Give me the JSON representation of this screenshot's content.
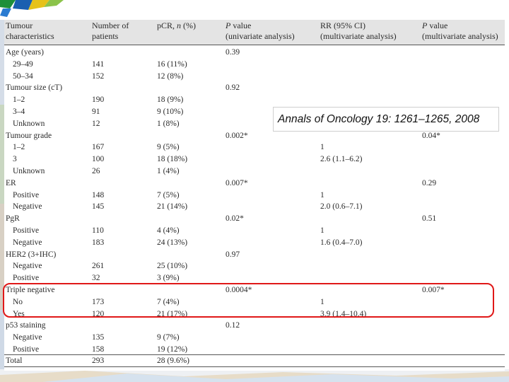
{
  "headers": [
    {
      "line1": "Tumour",
      "line2": "characteristics"
    },
    {
      "line1": "Number of",
      "line2": "patients"
    },
    {
      "line1_pre": "pCR, ",
      "line1_it": "n",
      "line1_post": " (%)",
      "line2": ""
    },
    {
      "line1_it": "P",
      "line1_post": " value",
      "line2": "(univariate analysis)"
    },
    {
      "line1_pre": "RR (95% CI)",
      "line2": "(multivariate analysis)"
    },
    {
      "line1_it": "P",
      "line1_post": " value",
      "line2": "(multivariate analysis)"
    }
  ],
  "rows": [
    {
      "label": "Age (years)",
      "indent": false,
      "n": "",
      "pcr": "",
      "p_uni": "0.39",
      "rr": "",
      "p_multi": ""
    },
    {
      "label": "29–49",
      "indent": true,
      "n": "141",
      "pcr": "16 (11%)",
      "p_uni": "",
      "rr": "",
      "p_multi": ""
    },
    {
      "label": "50–34",
      "indent": true,
      "n": "152",
      "pcr": "12 (8%)",
      "p_uni": "",
      "rr": "",
      "p_multi": ""
    },
    {
      "label": "Tumour size (cT)",
      "indent": false,
      "n": "",
      "pcr": "",
      "p_uni": "0.92",
      "rr": "",
      "p_multi": ""
    },
    {
      "label": "1–2",
      "indent": true,
      "n": "190",
      "pcr": "18 (9%)",
      "p_uni": "",
      "rr": "",
      "p_multi": ""
    },
    {
      "label": "3–4",
      "indent": true,
      "n": "91",
      "pcr": "9 (10%)",
      "p_uni": "",
      "rr": "",
      "p_multi": ""
    },
    {
      "label": "Unknown",
      "indent": true,
      "n": "12",
      "pcr": "1 (8%)",
      "p_uni": "",
      "rr": "",
      "p_multi": ""
    },
    {
      "label": "Tumour grade",
      "indent": false,
      "n": "",
      "pcr": "",
      "p_uni": "0.002*",
      "rr": "",
      "p_multi": "0.04*"
    },
    {
      "label": "1–2",
      "indent": true,
      "n": "167",
      "pcr": "9 (5%)",
      "p_uni": "",
      "rr": "1",
      "p_multi": ""
    },
    {
      "label": "3",
      "indent": true,
      "n": "100",
      "pcr": "18 (18%)",
      "p_uni": "",
      "rr": "2.6 (1.1–6.2)",
      "p_multi": ""
    },
    {
      "label": "Unknown",
      "indent": true,
      "n": "26",
      "pcr": "1 (4%)",
      "p_uni": "",
      "rr": "",
      "p_multi": ""
    },
    {
      "label": "ER",
      "indent": false,
      "n": "",
      "pcr": "",
      "p_uni": "0.007*",
      "rr": "",
      "p_multi": "0.29"
    },
    {
      "label": "Positive",
      "indent": true,
      "n": "148",
      "pcr": "7 (5%)",
      "p_uni": "",
      "rr": "1",
      "p_multi": ""
    },
    {
      "label": "Negative",
      "indent": true,
      "n": "145",
      "pcr": "21 (14%)",
      "p_uni": "",
      "rr": "2.0 (0.6–7.1)",
      "p_multi": ""
    },
    {
      "label": "PgR",
      "indent": false,
      "n": "",
      "pcr": "",
      "p_uni": "0.02*",
      "rr": "",
      "p_multi": "0.51"
    },
    {
      "label": "Positive",
      "indent": true,
      "n": "110",
      "pcr": "4 (4%)",
      "p_uni": "",
      "rr": "1",
      "p_multi": ""
    },
    {
      "label": "Negative",
      "indent": true,
      "n": "183",
      "pcr": "24 (13%)",
      "p_uni": "",
      "rr": "1.6 (0.4–7.0)",
      "p_multi": ""
    },
    {
      "label": "HER2 (3+IHC)",
      "indent": false,
      "n": "",
      "pcr": "",
      "p_uni": "0.97",
      "rr": "",
      "p_multi": ""
    },
    {
      "label": "Negative",
      "indent": true,
      "n": "261",
      "pcr": "25 (10%)",
      "p_uni": "",
      "rr": "",
      "p_multi": ""
    },
    {
      "label": "Positive",
      "indent": true,
      "n": "32",
      "pcr": "3 (9%)",
      "p_uni": "",
      "rr": "",
      "p_multi": ""
    },
    {
      "label": "Triple negative",
      "indent": false,
      "n": "",
      "pcr": "",
      "p_uni": "0.0004*",
      "rr": "",
      "p_multi": "0.007*"
    },
    {
      "label": "No",
      "indent": true,
      "n": "173",
      "pcr": "7 (4%)",
      "p_uni": "",
      "rr": "1",
      "p_multi": ""
    },
    {
      "label": "Yes",
      "indent": true,
      "n": "120",
      "pcr": "21 (17%)",
      "p_uni": "",
      "rr": "3.9 (1.4–10.4)",
      "p_multi": ""
    },
    {
      "label": "p53 staining",
      "indent": false,
      "n": "",
      "pcr": "",
      "p_uni": "0.12",
      "rr": "",
      "p_multi": ""
    },
    {
      "label": "Negative",
      "indent": true,
      "n": "135",
      "pcr": "9 (7%)",
      "p_uni": "",
      "rr": "",
      "p_multi": ""
    },
    {
      "label": "Positive",
      "indent": true,
      "n": "158",
      "pcr": "19 (12%)",
      "p_uni": "",
      "rr": "",
      "p_multi": ""
    },
    {
      "label": "Total",
      "indent": false,
      "n": "293",
      "pcr": "28 (9.6%)",
      "p_uni": "",
      "rr": "",
      "p_multi": ""
    }
  ],
  "citation": "Annals of Oncology 19: 1261–1265, 2008",
  "colors": {
    "highlight": "#e01818",
    "header_band": "#e4e4e4"
  }
}
